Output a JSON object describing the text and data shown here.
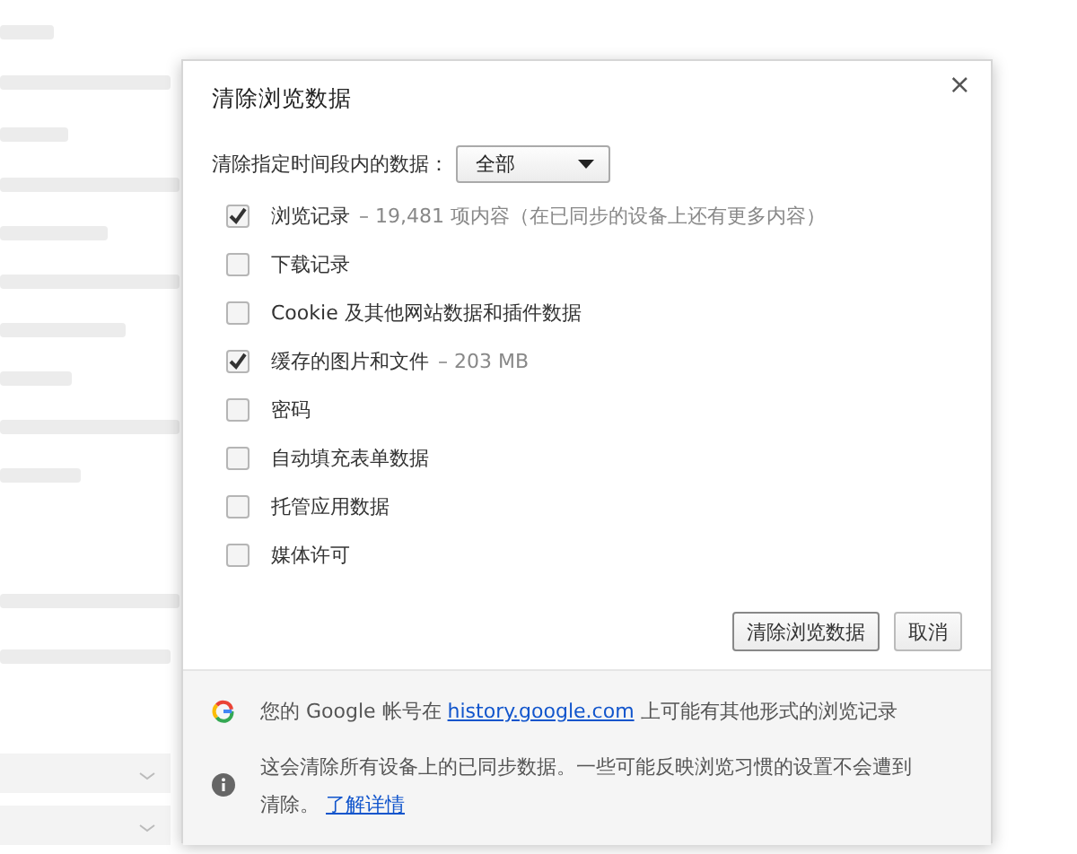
{
  "dialog": {
    "title": "清除浏览数据",
    "close": "×",
    "range": {
      "label": "清除指定时间段内的数据：",
      "value": "全部"
    },
    "items": [
      {
        "label": "浏览记录",
        "detail": "– 19,481 项内容（在已同步的设备上还有更多内容）",
        "checked": true
      },
      {
        "label": "下载记录",
        "checked": false
      },
      {
        "label": "Cookie 及其他网站数据和插件数据",
        "checked": false
      },
      {
        "label": "缓存的图片和文件",
        "detail": "– 203 MB",
        "checked": true
      },
      {
        "label": "密码",
        "checked": false
      },
      {
        "label": "自动填充表单数据",
        "checked": false
      },
      {
        "label": "托管应用数据",
        "checked": false
      },
      {
        "label": "媒体许可",
        "checked": false
      }
    ],
    "buttons": [
      "清除浏览数据",
      "取消"
    ],
    "footer": {
      "google": {
        "before": "您的 Google 帐号在",
        "link": "history.google.com",
        "after": "上可能有其他形式的浏览记录"
      },
      "info": {
        "text": "这会清除所有设备上的已同步数据。一些可能反映浏览习惯的设置不会遭到清除。",
        "link": "了解详情"
      }
    }
  }
}
